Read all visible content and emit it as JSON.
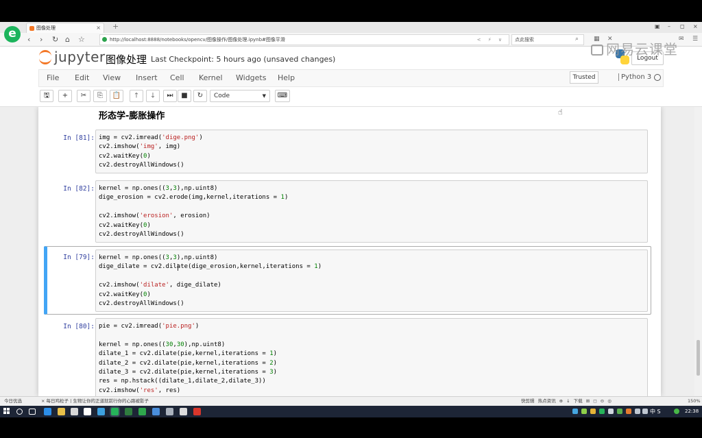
{
  "browser": {
    "logo_glyph": "e",
    "tab_title": "图像处理",
    "tab_close": "×",
    "new_tab": "+",
    "window_controls": [
      "▣",
      "–",
      "◻",
      "×"
    ],
    "nav_icons": [
      "back-icon",
      "forward-icon",
      "home-icon",
      "reload-icon",
      "star-icon"
    ],
    "nav_glyphs": [
      "‹",
      "›",
      "⌂",
      "↻",
      "☆"
    ],
    "url": "http://localhost:8888/notebooks/opencv/图像操作/图像处理.ipynb#图像平滑",
    "url_actions": "< ⚡ ∨",
    "search_placeholder": "点此搜索",
    "search_glyph": "⌕",
    "toolbar_glyphs": [
      "▦",
      "✕",
      "✉",
      "☰"
    ],
    "watermark": "网易云课堂"
  },
  "jupyter": {
    "logo_text": "jupyter",
    "notebook_title": "图像处理",
    "checkpoint": "Last Checkpoint: 5 hours ago (unsaved changes)",
    "logout_label": "Logout",
    "menu": [
      "File",
      "Edit",
      "View",
      "Insert",
      "Cell",
      "Kernel",
      "Widgets",
      "Help"
    ],
    "trusted_label": "Trusted",
    "kernel_name": "Python 3",
    "toolbar": {
      "save": "🖫",
      "add": "+",
      "cut": "✂",
      "copy": "⎘",
      "paste": "📋",
      "up": "🡑",
      "down": "🡓",
      "run": "⏭",
      "stop": "■",
      "restart": "↻",
      "keyboard": "⌨"
    },
    "cell_type": "Code",
    "cell_type_caret": "▼"
  },
  "notebook": {
    "markdown_heading": "形态学-膨胀操作",
    "cells": [
      {
        "prompt": "In [81]:",
        "lines": [
          "img = cv2.imread('dige.png')",
          "cv2.imshow('img', img)",
          "cv2.waitKey(0)",
          "cv2.destroyAllWindows()"
        ]
      },
      {
        "prompt": "In [82]:",
        "lines": [
          "kernel = np.ones((3,3),np.uint8)",
          "dige_erosion = cv2.erode(img,kernel,iterations = 1)",
          "",
          "cv2.imshow('erosion', erosion)",
          "cv2.waitKey(0)",
          "cv2.destroyAllWindows()"
        ]
      },
      {
        "prompt": "In [79]:",
        "selected": true,
        "lines": [
          "kernel = np.ones((3,3),np.uint8)",
          "dige_dilate = cv2.dilate(dige_erosion,kernel,iterations = 1)",
          "",
          "cv2.imshow('dilate', dige_dilate)",
          "cv2.waitKey(0)",
          "cv2.destroyAllWindows()"
        ]
      },
      {
        "prompt": "In [80]:",
        "lines": [
          "pie = cv2.imread('pie.png')",
          "",
          "kernel = np.ones((30,30),np.uint8)",
          "dilate_1 = cv2.dilate(pie,kernel,iterations = 1)",
          "dilate_2 = cv2.dilate(pie,kernel,iterations = 2)",
          "dilate_3 = cv2.dilate(pie,kernel,iterations = 3)",
          "res = np.hstack((dilate_1,dilate_2,dilate_3))",
          "cv2.imshow('res', res)"
        ]
      }
    ]
  },
  "statusbar": {
    "left": "今日优选",
    "news": "× 每日鸡粒子丨生物让你的正道就前行你的心路被影子",
    "right": "快剪辑  热点资讯  ⊕  ↓  下载  ⊞  ◻  ⊝  ◎",
    "zoom": "150%"
  },
  "taskbar": {
    "ime": "中 S",
    "clock": "22:38"
  },
  "colors": {
    "jupyter_orange": "#f37726",
    "selected_cell_bar": "#42a5f5",
    "prompt_blue": "#303f9f",
    "string_red": "#ba2121",
    "number_green": "#008000"
  }
}
